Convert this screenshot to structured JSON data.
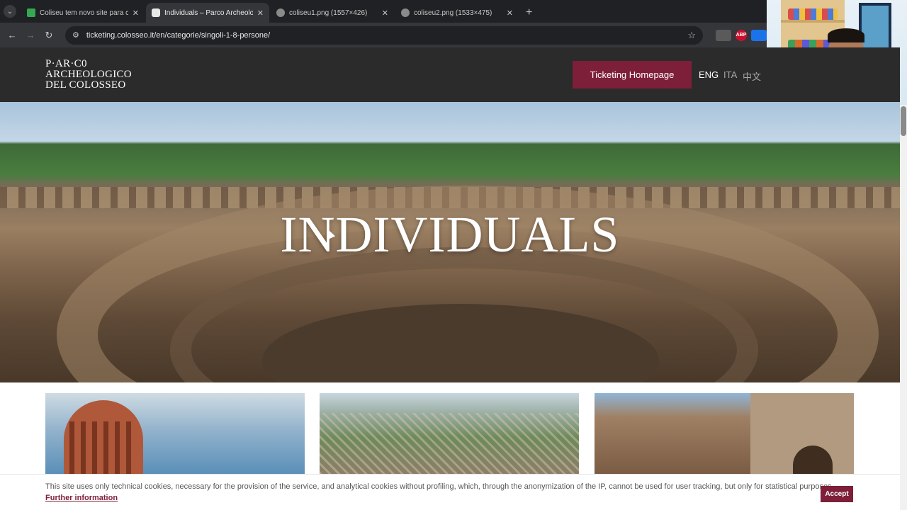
{
  "browser": {
    "tabs": [
      {
        "title": "Coliseu tem novo site para com",
        "favicon_color": "#34a853"
      },
      {
        "title": "Individuals – Parco Archeologic",
        "favicon_color": "#e8e8e8"
      },
      {
        "title": "coliseu1.png (1557×426)",
        "favicon_color": "#8a8a8a"
      },
      {
        "title": "coliseu2.png (1533×475)",
        "favicon_color": "#8a8a8a"
      }
    ],
    "close_glyph": "✕",
    "new_tab_glyph": "+",
    "url": "ticketing.colosseo.it/en/categorie/singoli-1-8-persone/",
    "extensions": [
      {
        "label": "",
        "color": "#5a5a5a"
      },
      {
        "label": "ABP",
        "color": "#c8102e"
      },
      {
        "label": "",
        "color": "#1a73e8"
      }
    ]
  },
  "site": {
    "logo_lines": [
      "P·AR·C0",
      "ARCHEOLOGICO",
      "DEL COLOSSEO"
    ],
    "homepage_button": "Ticketing Homepage",
    "languages": [
      "ENG",
      "ITA",
      "中文"
    ],
    "accent_color": "#7e1f3a"
  },
  "hero": {
    "title": "INDIVIDUALS"
  },
  "cookie": {
    "text": "This site uses only technical cookies, necessary for the provision of the service, and analytical cookies without profiling, which, through the anonymization of the IP, cannot be used for user tracking, but only for statistical purposes.",
    "link": "Further information",
    "accept": "Accept"
  }
}
